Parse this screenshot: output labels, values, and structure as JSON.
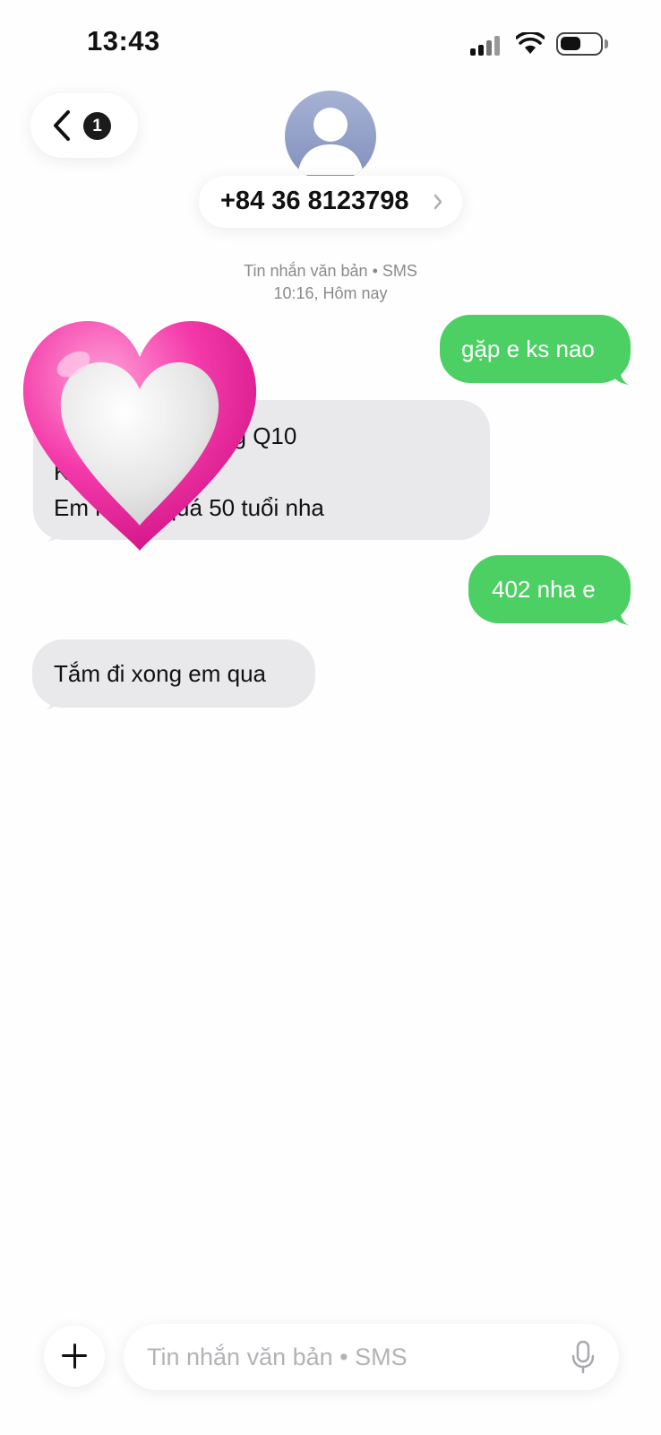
{
  "status_bar": {
    "time": "13:43",
    "signal_icon": "cellular-signal-icon",
    "wifi_icon": "wifi-icon",
    "battery_icon": "battery-icon"
  },
  "header": {
    "back_icon": "chevron-left-icon",
    "unread_count": "1",
    "avatar_icon": "person-avatar-icon",
    "contact_name": "+84 36 8123798",
    "contact_chevron_icon": "chevron-right-icon"
  },
  "conversation": {
    "meta_line1": "Tin nhắn văn bản • SMS",
    "meta_line2": "10:16, Hôm nay",
    "messages": [
      {
        "direction": "sent",
        "lines": [
          "gặp e ks nao"
        ]
      },
      {
        "direction": "received",
        "lines": [
          "Kh          nh P hòa Hưng Q10",
          "K",
          "Em         người quá 50 tuổi nha"
        ]
      },
      {
        "direction": "sent",
        "lines": [
          "402 nha e"
        ]
      },
      {
        "direction": "received",
        "lines": [
          "Tắm đi xong em qua"
        ]
      }
    ],
    "sticker": "pink-heart-sticker"
  },
  "composer": {
    "add_icon": "plus-icon",
    "placeholder": "Tin nhắn văn bản • SMS",
    "value": "",
    "mic_icon": "microphone-icon"
  },
  "colors": {
    "sent_bubble": "#4cd064",
    "received_bubble": "#e9e9eb",
    "background": "#fefefe",
    "heart": "#f0179a"
  }
}
